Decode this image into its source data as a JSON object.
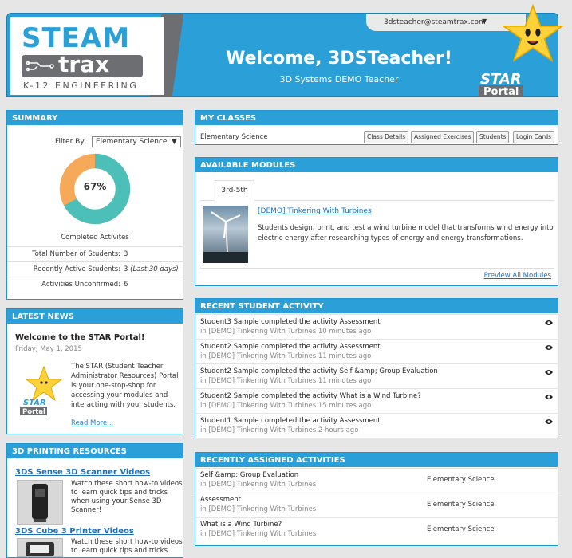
{
  "header": {
    "logo_steam": "STEAM",
    "logo_trax": "trax",
    "logo_tagline": "K-12 ENGINEERING",
    "welcome": "Welcome, 3DSTeacher!",
    "subtitle": "3D Systems DEMO Teacher",
    "user_email": "3dsteacher@steamtrax.com",
    "user_caret": "▼",
    "portal_star": "STAR",
    "portal_word": "Portal"
  },
  "summary": {
    "title": "SUMMARY",
    "filter_label": "Filter By:",
    "filter_value": "Elementary Science",
    "filter_caret": "▼",
    "percent": 67,
    "percent_label": "67%",
    "completed_label": "Completed Activites",
    "colors": {
      "complete": "#4bbfb8",
      "remaining": "#f7a95a"
    },
    "stats": [
      {
        "label": "Total Number of Students:",
        "value": "3",
        "note": ""
      },
      {
        "label": "Recently Active Students:",
        "value": "3",
        "note": "(Last 30 days)"
      },
      {
        "label": "Activities Unconfirmed:",
        "value": "6",
        "note": ""
      }
    ]
  },
  "news": {
    "title": "LATEST NEWS",
    "headline": "Welcome to the STAR Portal!",
    "date": "Friday, May 1, 2015",
    "body": "The STAR (Student Teacher Administrator Resources) Portal is your one-stop-shop for accessing your modules and interacting with your students.",
    "read_more": "Read More...",
    "logo_star": "STAR",
    "logo_portal": "Portal"
  },
  "printing": {
    "title": "3D PRINTING RESOURCES",
    "items": [
      {
        "link": "3DS Sense 3D Scanner Videos",
        "text": "Watch these short how-to videos to learn quick tips and tricks when using your Sense 3D Scanner!"
      },
      {
        "link": "3DS Cube 3 Printer Videos",
        "text": "Watch these short how-to videos to learn quick tips and tricks"
      }
    ]
  },
  "classes": {
    "title": "MY CLASSES",
    "class_name": "Elementary Science",
    "buttons": [
      "Class Details",
      "Assigned Exercises",
      "Students",
      "Login Cards"
    ]
  },
  "modules": {
    "title": "AVAILABLE MODULES",
    "tab": "3rd-5th",
    "module_title": "[DEMO] Tinkering With Turbines",
    "module_desc": "Students design, print, and test a wind turbine model that transforms wind energy into electric energy after researching types of energy and energy transformations.",
    "preview_all": "Preview All Modules"
  },
  "activity": {
    "title": "RECENT STUDENT ACTIVITY",
    "rows": [
      {
        "main": "Student3 Sample completed the activity Assessment",
        "sub": "in [DEMO] Tinkering With Turbines 10 minutes ago"
      },
      {
        "main": "Student2 Sample completed the activity Assessment",
        "sub": "in [DEMO] Tinkering With Turbines 11 minutes ago"
      },
      {
        "main": "Student2 Sample completed the activity Self &amp; Group Evaluation",
        "sub": "in [DEMO] Tinkering With Turbines 11 minutes ago"
      },
      {
        "main": "Student2 Sample completed the activity What is a Wind Turbine?",
        "sub": "in [DEMO] Tinkering With Turbines 15 minutes ago"
      },
      {
        "main": "Student1 Sample completed the activity Assessment",
        "sub": "in [DEMO] Tinkering With Turbines 2 hours ago"
      }
    ]
  },
  "assigned": {
    "title": "RECENTLY ASSIGNED ACTIVITIES",
    "rows": [
      {
        "main": "Self &amp; Group Evaluation",
        "sub": "in [DEMO] Tinkering With Turbines",
        "class": "Elementary Science"
      },
      {
        "main": "Assessment",
        "sub": "in [DEMO] Tinkering With Turbines",
        "class": "Elementary Science"
      },
      {
        "main": "What is a Wind Turbine?",
        "sub": "in [DEMO] Tinkering With Turbines",
        "class": "Elementary Science"
      }
    ]
  }
}
